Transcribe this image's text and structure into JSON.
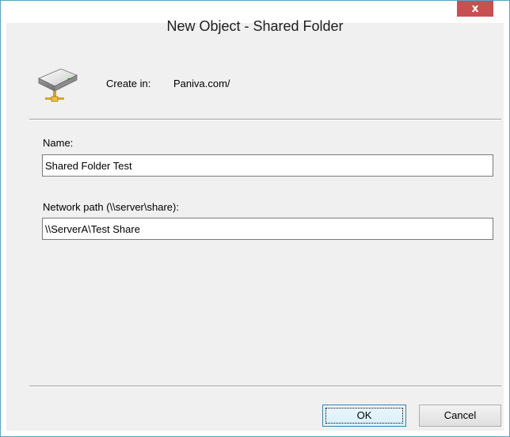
{
  "window": {
    "title": "New Object - Shared Folder",
    "close_glyph": "x",
    "close_color": "#c75050",
    "frame_color": "#5aa3c4"
  },
  "header": {
    "icon": "shared-folder-icon",
    "create_in_label": "Create in:",
    "create_in_value": "Paniva.com/"
  },
  "form": {
    "name_label": "Name:",
    "name_value": "Shared Folder Test",
    "path_label": "Network path (\\\\server\\share):",
    "path_value": "\\\\ServerA\\Test Share"
  },
  "buttons": {
    "ok_label": "OK",
    "cancel_label": "Cancel"
  }
}
